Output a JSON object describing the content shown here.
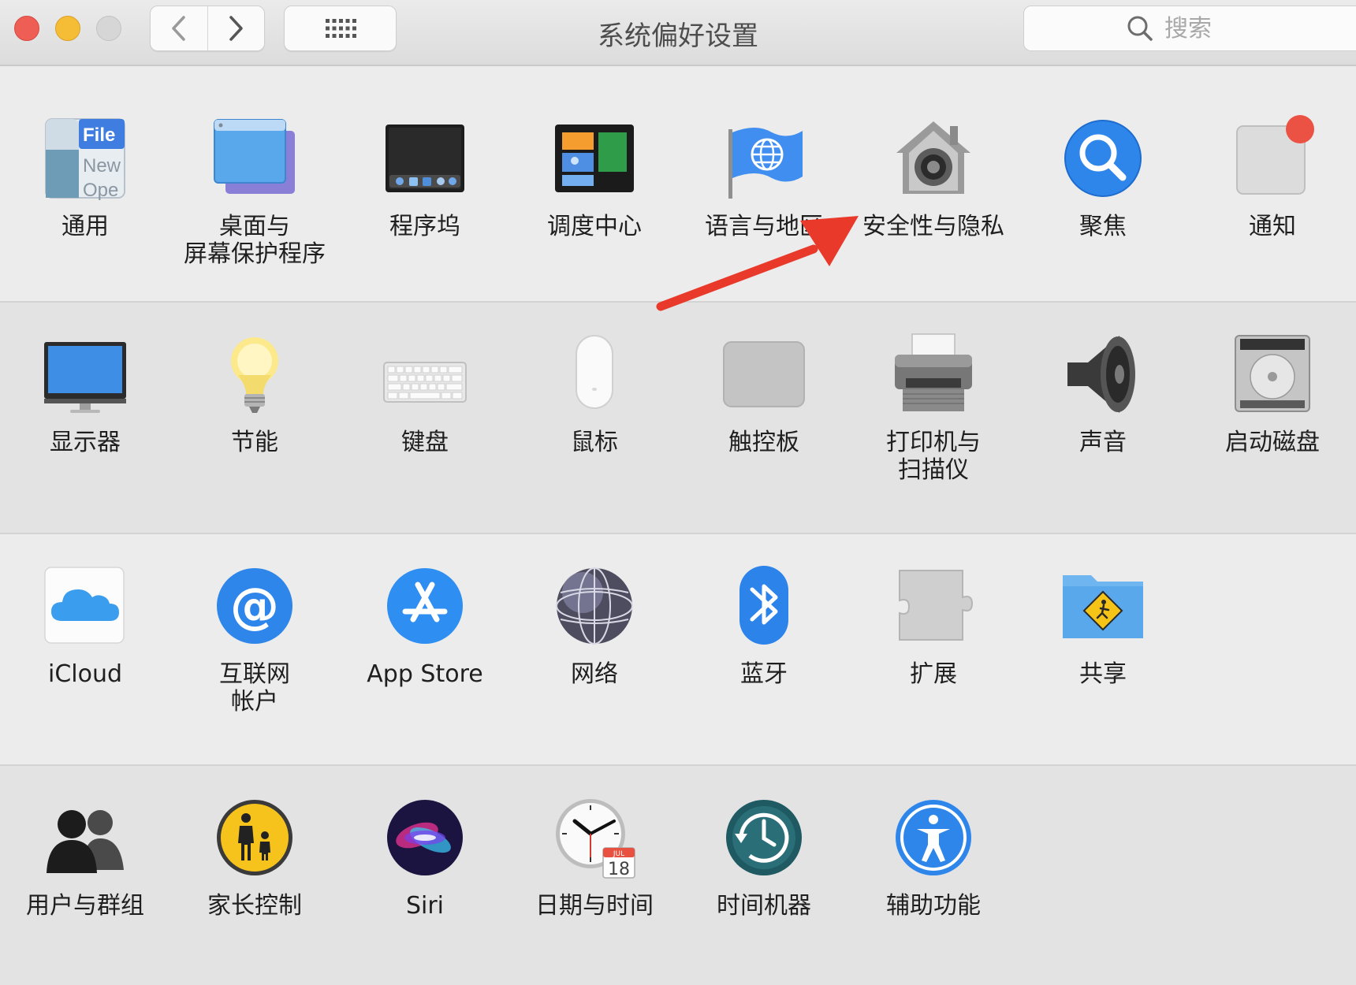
{
  "window": {
    "title": "系统偏好设置",
    "search_placeholder": "搜索"
  },
  "colors": {
    "close": "#ee5e55",
    "minimize": "#f5bd35",
    "zoom": "#d6d6d6",
    "annotation_arrow": "#e8392a"
  },
  "rows": [
    {
      "items": [
        {
          "icon": "general-icon",
          "label": "通用"
        },
        {
          "icon": "desktop-screensaver-icon",
          "label": "桌面与\n屏幕保护程序"
        },
        {
          "icon": "dock-icon",
          "label": "程序坞"
        },
        {
          "icon": "mission-control-icon",
          "label": "调度中心"
        },
        {
          "icon": "language-region-icon",
          "label": "语言与地区"
        },
        {
          "icon": "security-privacy-icon",
          "label": "安全性与隐私"
        },
        {
          "icon": "spotlight-icon",
          "label": "聚焦"
        },
        {
          "icon": "notifications-icon",
          "label": "通知"
        }
      ]
    },
    {
      "items": [
        {
          "icon": "displays-icon",
          "label": "显示器"
        },
        {
          "icon": "energy-saver-icon",
          "label": "节能"
        },
        {
          "icon": "keyboard-icon",
          "label": "键盘"
        },
        {
          "icon": "mouse-icon",
          "label": "鼠标"
        },
        {
          "icon": "trackpad-icon",
          "label": "触控板"
        },
        {
          "icon": "printers-scanners-icon",
          "label": "打印机与\n扫描仪"
        },
        {
          "icon": "sound-icon",
          "label": "声音"
        },
        {
          "icon": "startup-disk-icon",
          "label": "启动磁盘"
        }
      ]
    },
    {
      "items": [
        {
          "icon": "icloud-icon",
          "label": "iCloud"
        },
        {
          "icon": "internet-accounts-icon",
          "label": "互联网\n帐户"
        },
        {
          "icon": "app-store-icon",
          "label": "App Store"
        },
        {
          "icon": "network-icon",
          "label": "网络"
        },
        {
          "icon": "bluetooth-icon",
          "label": "蓝牙"
        },
        {
          "icon": "extensions-icon",
          "label": "扩展"
        },
        {
          "icon": "sharing-icon",
          "label": "共享"
        }
      ]
    },
    {
      "items": [
        {
          "icon": "users-groups-icon",
          "label": "用户与群组"
        },
        {
          "icon": "parental-controls-icon",
          "label": "家长控制"
        },
        {
          "icon": "siri-icon",
          "label": "Siri"
        },
        {
          "icon": "date-time-icon",
          "label": "日期与时间"
        },
        {
          "icon": "time-machine-icon",
          "label": "时间机器"
        },
        {
          "icon": "accessibility-icon",
          "label": "辅助功能"
        }
      ]
    }
  ],
  "icon_text": {
    "general_file": "File",
    "general_new": "New",
    "general_open": "Ope",
    "calendar_month": "JUL",
    "calendar_day": "18"
  }
}
